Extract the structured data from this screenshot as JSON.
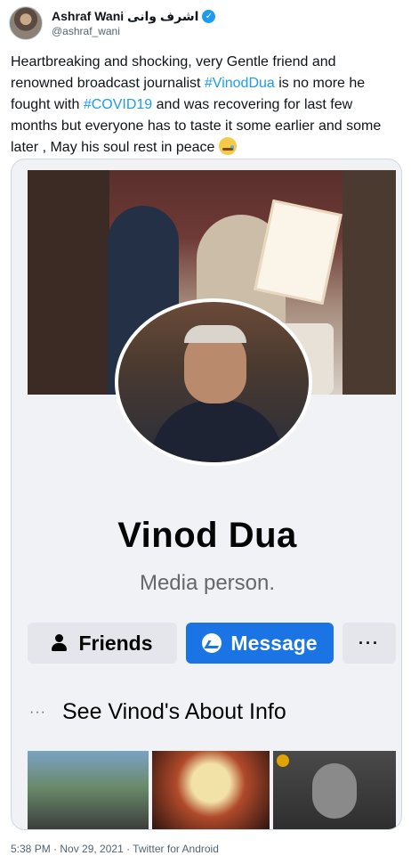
{
  "tweet": {
    "display_name": "Ashraf Wani اشرف وانی",
    "handle": "@ashraf_wani",
    "text_part1": "Heartbreaking and shocking, very  Gentle friend and renowned broadcast journalist ",
    "hashtag1": "#VinodDua",
    "text_part2": " is no more he fought with ",
    "hashtag2": "#COVID19",
    "text_part3": " and was recovering for last few months but everyone has to taste it some earlier and some later , May his soul rest in peace ",
    "footer": "5:38 PM · Nov 29, 2021 · Twitter for Android"
  },
  "profile_card": {
    "name": "Vinod Dua",
    "bio": "Media person.",
    "friends_label": "Friends",
    "message_label": "Message",
    "more_label": "···",
    "about_dots": "···",
    "about_label": "See Vinod's About Info"
  },
  "icons": {
    "verified": "verified-badge-icon",
    "friends": "person-icon",
    "message": "messenger-icon",
    "emoji": "crying-face-emoji"
  },
  "colors": {
    "link": "#1d9bf0",
    "fb_blue": "#1b74e4",
    "muted": "#536471"
  }
}
